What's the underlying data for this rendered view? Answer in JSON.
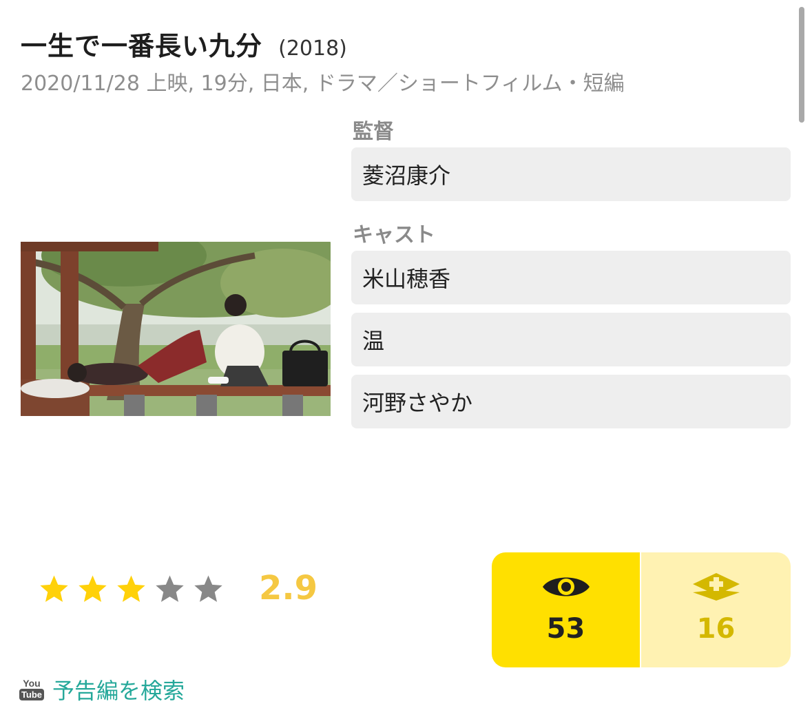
{
  "movie": {
    "title": "一生で一番長い九分",
    "year": "(2018)",
    "meta": "2020/11/28 上映, 19分, 日本, ドラマ／ショートフィルム・短編"
  },
  "credits": {
    "director_label": "監督",
    "director": "菱沼康介",
    "cast_label": "キャスト",
    "cast": [
      " 米山穂香",
      "温",
      "河野さやか"
    ]
  },
  "rating": {
    "score": "2.9",
    "value": 2.9,
    "max": 5,
    "filled_color": "#ffd10a",
    "empty_color": "#888888"
  },
  "counters": {
    "seen_icon": "eye-icon",
    "seen_count": "53",
    "clip_icon": "clip-add-icon",
    "clip_count": "16"
  },
  "trailer": {
    "icon": "youtube-icon",
    "icon_top": "You",
    "icon_bottom": "Tube",
    "label": "予告編を検索"
  },
  "colors": {
    "accent_yellow": "#ffe000",
    "accent_yellow_light": "#fff2b2",
    "link_teal": "#25a89a"
  }
}
